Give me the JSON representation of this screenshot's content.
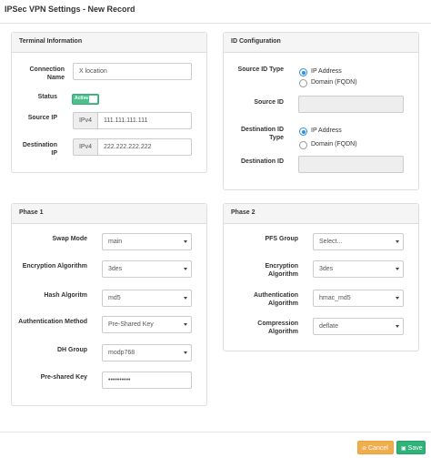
{
  "dialog": {
    "title": "IPSec VPN Settings - New Record"
  },
  "terminal": {
    "title": "Terminal Information",
    "connection_name_label": "Connection Name",
    "connection_name_value": "X location",
    "status_label": "Status",
    "status_value": "Active",
    "source_ip_label": "Source IP",
    "source_ip_prefix": "IPv4",
    "source_ip_value": "111.111.111.111",
    "destination_ip_label": "Destination IP",
    "destination_ip_prefix": "IPv4",
    "destination_ip_value": "222.222.222.222"
  },
  "id_config": {
    "title": "ID Configuration",
    "source_id_type_label": "Source ID Type",
    "source_id_options": [
      "IP Address",
      "Domain (FQDN)"
    ],
    "source_id_selected": "IP Address",
    "source_id_label": "Source ID",
    "destination_id_type_label": "Destination ID Type",
    "destination_id_options": [
      "IP Address",
      "Domain (FQDN)"
    ],
    "destination_id_selected": "IP Address",
    "destination_id_label": "Destination ID"
  },
  "phase1": {
    "title": "Phase 1",
    "swap_mode_label": "Swap Mode",
    "swap_mode_value": "main",
    "encryption_label": "Encryption Algorithm",
    "encryption_value": "3des",
    "hash_label": "Hash Algoritm",
    "hash_value": "md5",
    "auth_method_label": "Authentication Method",
    "auth_method_value": "Pre-Shared Key",
    "dh_group_label": "DH Group",
    "dh_group_value": "modp768",
    "psk_label": "Pre-shared Key",
    "psk_value": "••••••••••"
  },
  "phase2": {
    "title": "Phase 2",
    "pfs_group_label": "PFS Group",
    "pfs_group_value": "Select...",
    "encryption_label": "Encryption Algorithm",
    "encryption_value": "3des",
    "auth_algorithm_label": "Authentication Algorithm",
    "auth_algorithm_value": "hmac_md5",
    "compression_label": "Compression Algorithm",
    "compression_value": "deflate"
  },
  "footer": {
    "cancel_label": "Cancel",
    "save_label": "Save",
    "cancel_icon": "cancel-circle-icon",
    "save_icon": "save-disk-icon"
  },
  "colors": {
    "toggle_active": "#4cc08e",
    "radio_selected": "#2f8ee0",
    "cancel_button": "#f0ad4e",
    "save_button": "#2fb379"
  }
}
